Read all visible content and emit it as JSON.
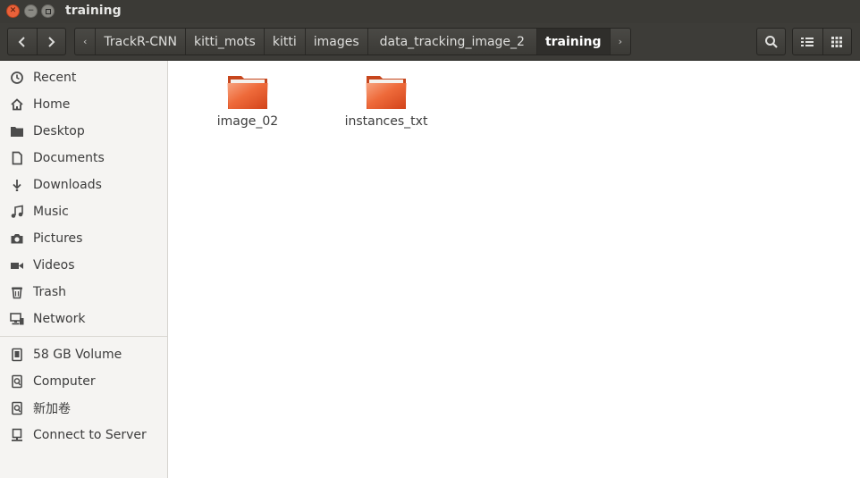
{
  "window": {
    "title": "training"
  },
  "breadcrumb": {
    "items": [
      "TrackR-CNN",
      "kitti_mots",
      "kitti",
      "images",
      "data_tracking_image_2",
      "training"
    ]
  },
  "sidebar": {
    "places": [
      {
        "label": "Recent",
        "icon": "clock-icon"
      },
      {
        "label": "Home",
        "icon": "home-icon"
      },
      {
        "label": "Desktop",
        "icon": "desktop-folder-icon"
      },
      {
        "label": "Documents",
        "icon": "document-icon"
      },
      {
        "label": "Downloads",
        "icon": "download-icon"
      },
      {
        "label": "Music",
        "icon": "music-icon"
      },
      {
        "label": "Pictures",
        "icon": "camera-icon"
      },
      {
        "label": "Videos",
        "icon": "video-icon"
      },
      {
        "label": "Trash",
        "icon": "trash-icon"
      },
      {
        "label": "Network",
        "icon": "network-icon"
      }
    ],
    "devices": [
      {
        "label": "58 GB Volume",
        "icon": "drive-icon"
      },
      {
        "label": "Computer",
        "icon": "computer-icon"
      },
      {
        "label": "新加卷",
        "icon": "drive-icon"
      },
      {
        "label": "Connect to Server",
        "icon": "server-icon"
      }
    ]
  },
  "files": [
    {
      "name": "image_02",
      "type": "folder"
    },
    {
      "name": "instances_txt",
      "type": "folder"
    }
  ],
  "colors": {
    "folder": "#e95420",
    "titlebar": "#3b3a36",
    "close_button": "#e9613a"
  }
}
